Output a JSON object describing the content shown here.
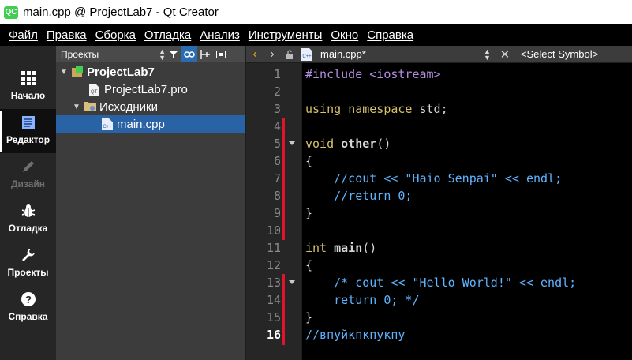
{
  "window": {
    "title": "main.cpp @ ProjectLab7 - Qt Creator",
    "logo_text": "QC"
  },
  "menubar": {
    "items": [
      "Файл",
      "Правка",
      "Сборка",
      "Отладка",
      "Анализ",
      "Инструменты",
      "Окно",
      "Справка"
    ]
  },
  "modes": [
    {
      "label": "Начало",
      "icon": "grid-icon"
    },
    {
      "label": "Редактор",
      "icon": "document-icon"
    },
    {
      "label": "Дизайн",
      "icon": "pencil-icon"
    },
    {
      "label": "Отладка",
      "icon": "bug-icon"
    },
    {
      "label": "Проекты",
      "icon": "wrench-icon"
    },
    {
      "label": "Справка",
      "icon": "help-icon"
    }
  ],
  "projects": {
    "view_label": "Проекты",
    "tree": {
      "project": "ProjectLab7",
      "pro_file": "ProjectLab7.pro",
      "sources_folder": "Исходники",
      "source_file": "main.cpp"
    }
  },
  "editor": {
    "file_label": "main.cpp*",
    "symbol_selector": "<Select Symbol>",
    "current_line": 16,
    "line_numbers": [
      "1",
      "2",
      "3",
      "4",
      "5",
      "6",
      "7",
      "8",
      "9",
      "10",
      "11",
      "12",
      "13",
      "14",
      "15",
      "16"
    ],
    "lines": [
      "#include <iostream>",
      "",
      "using namespace std;",
      "",
      "void other()",
      "{",
      "    //cout << \"Haio Senpai\" << endl;",
      "    //return 0;",
      "}",
      "",
      "int main()",
      "{",
      "    /* cout << \"Hello World!\" << endl;",
      "    return 0; */",
      "}",
      "//впуйкпкпукпу"
    ]
  },
  "colors": {
    "accent": "#2a62a6",
    "change_marker": "#e0142c",
    "keyword": "#d6c26a",
    "preprocessor": "#b48ee0",
    "comment": "#5fb3ff"
  }
}
